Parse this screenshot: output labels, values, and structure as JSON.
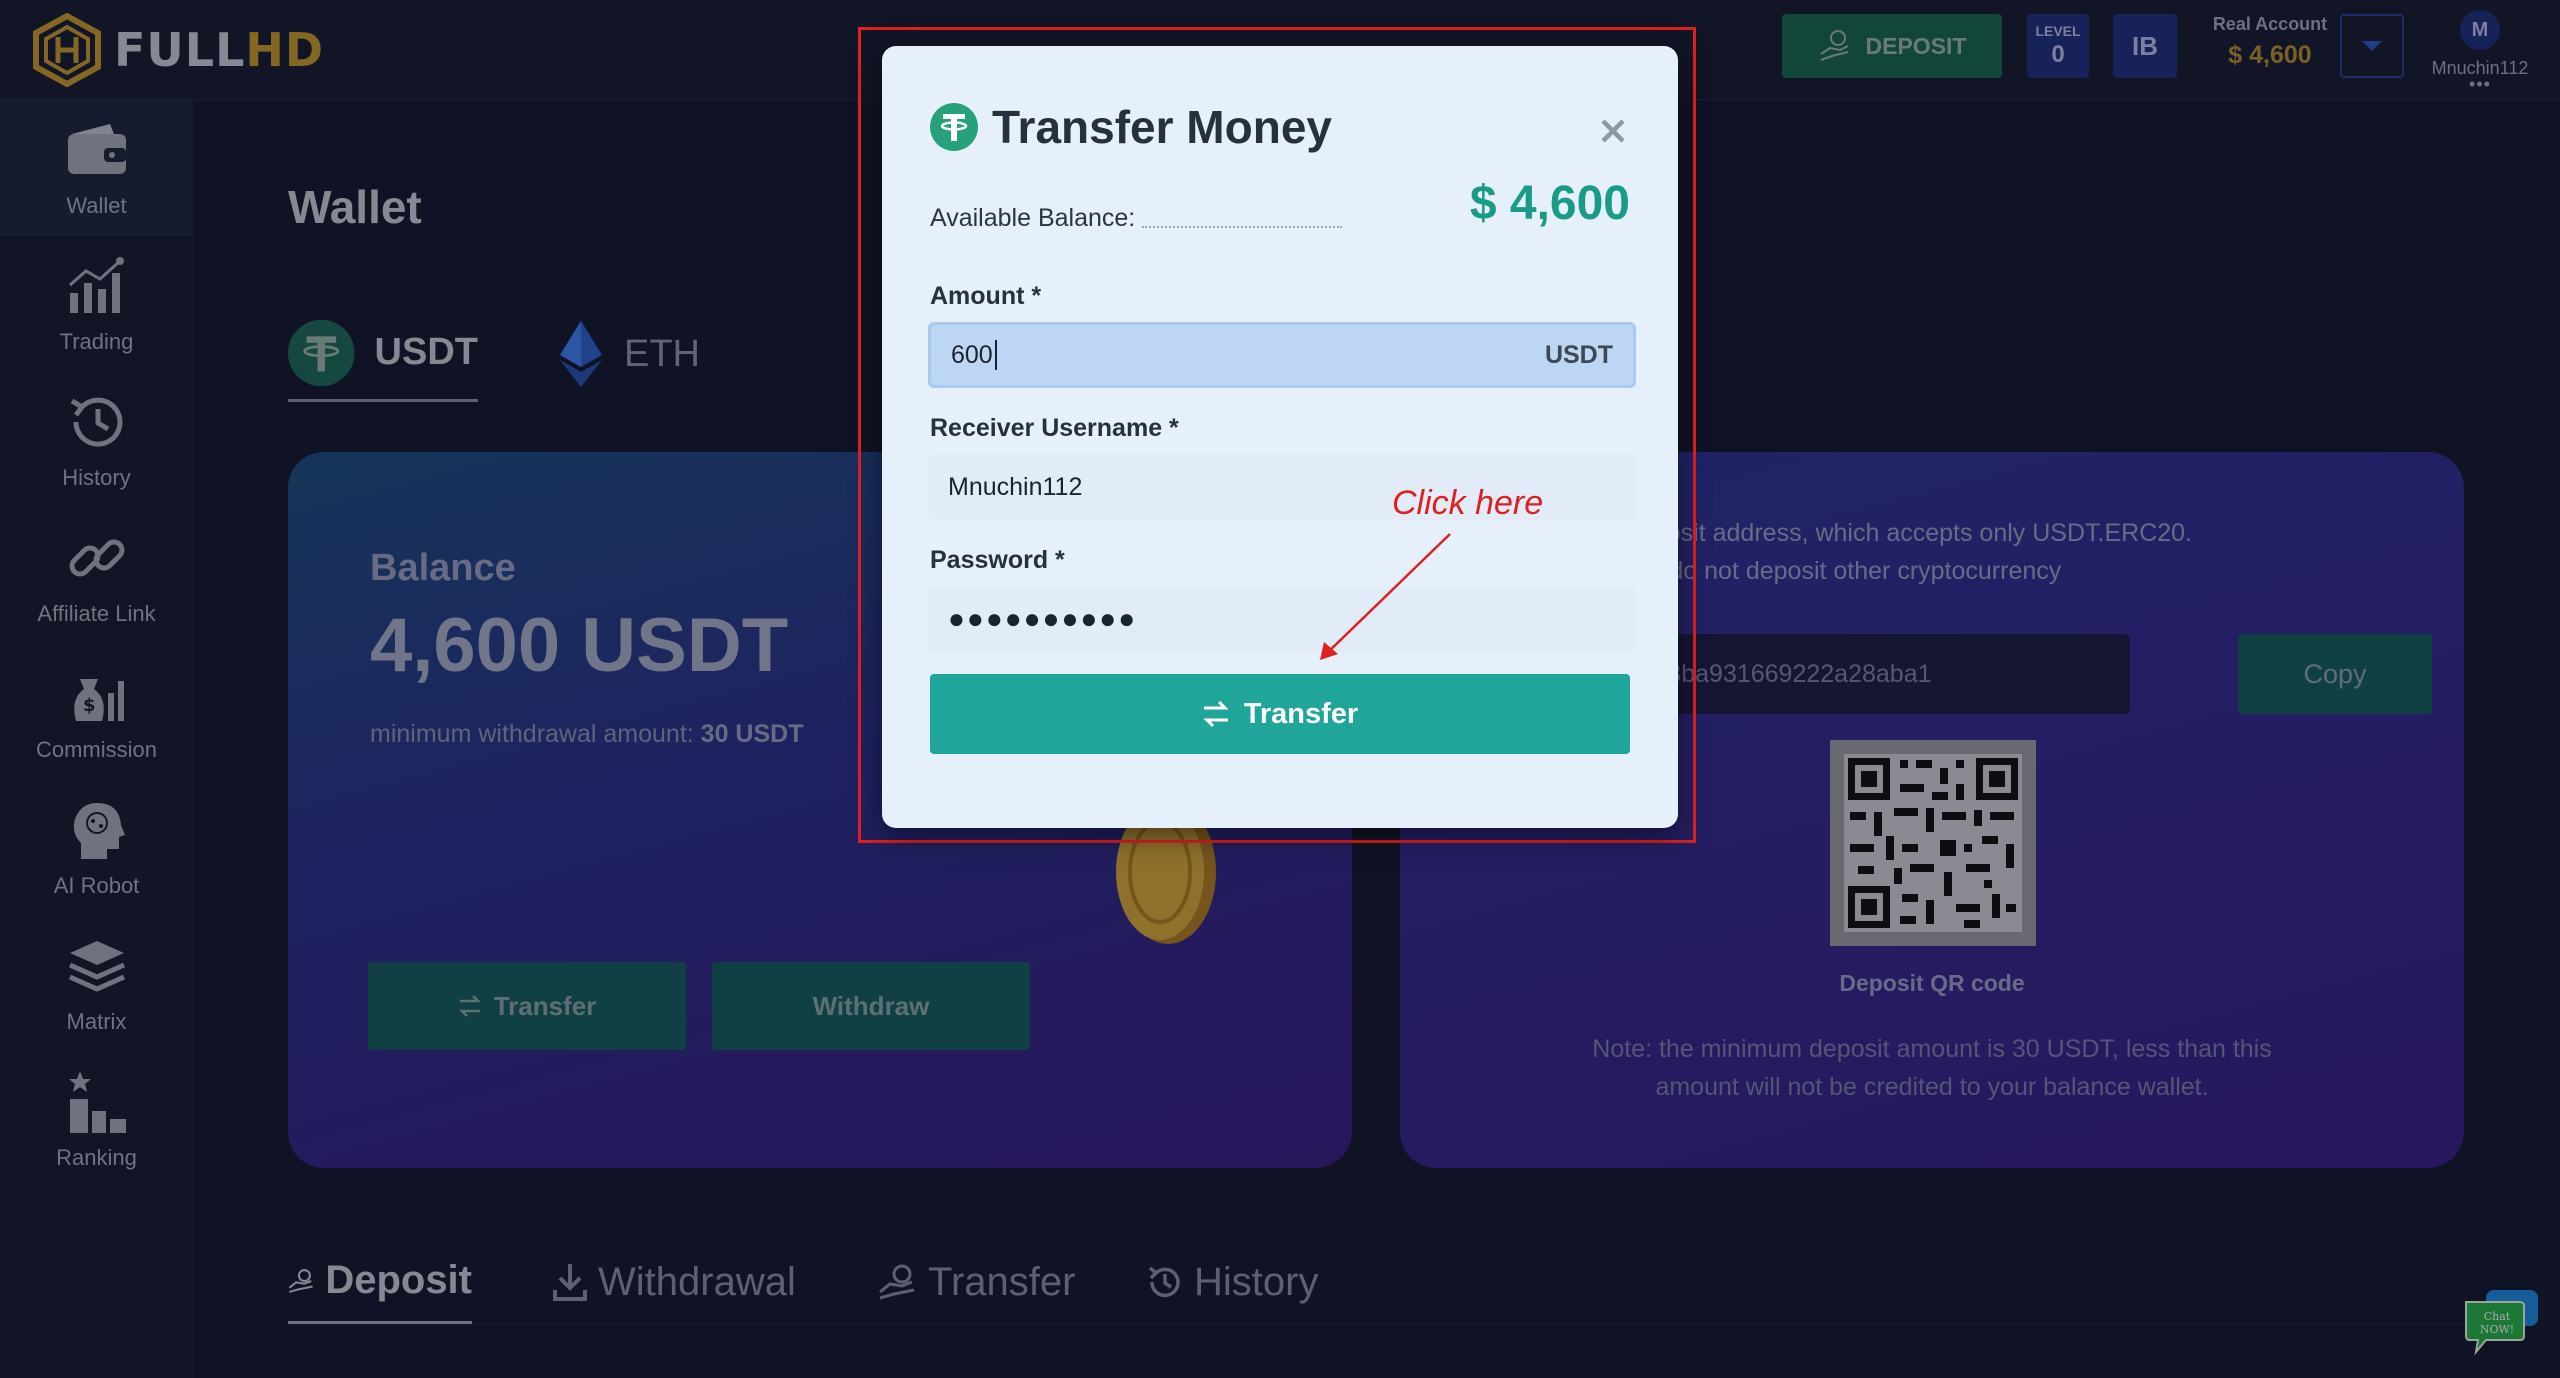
{
  "app": {
    "logo_full": "FULL",
    "logo_hd": "HD"
  },
  "header": {
    "deposit_label": "DEPOSIT",
    "level_label": "LEVEL",
    "level_value": "0",
    "ib_label": "IB",
    "account_type": "Real Account",
    "account_balance": "$ 4,600",
    "avatar_initial": "M",
    "username": "Mnuchin112",
    "more": "•••"
  },
  "sidebar": {
    "items": [
      {
        "label": "Wallet",
        "icon": "wallet-icon"
      },
      {
        "label": "Trading",
        "icon": "trading-chart-icon"
      },
      {
        "label": "History",
        "icon": "history-icon"
      },
      {
        "label": "Affiliate Link",
        "icon": "link-icon"
      },
      {
        "label": "Commission",
        "icon": "money-bag-icon"
      },
      {
        "label": "AI Robot",
        "icon": "brain-head-icon"
      },
      {
        "label": "Matrix",
        "icon": "layers-icon"
      },
      {
        "label": "Ranking",
        "icon": "podium-icon"
      }
    ]
  },
  "main": {
    "title": "Wallet",
    "coin_tabs": [
      {
        "label": "USDT",
        "icon": "tether-icon"
      },
      {
        "label": "ETH",
        "icon": "ethereum-icon"
      }
    ],
    "balance_card": {
      "label": "Balance",
      "value": "4,600 USDT",
      "min_prefix": "minimum withdrawal amount:",
      "min_value": "30 USDT",
      "transfer_label": "Transfer",
      "withdraw_label": "Withdraw"
    },
    "deposit_card": {
      "note_line1": "et's deposit address, which accepts only USDT.ERC20.",
      "note_line2": "Please do not deposit other cryptocurrency",
      "address": "5147a983ba931669222a28aba1",
      "copy_label": "Copy",
      "qr_label": "Deposit QR code",
      "note_bottom": "Note: the minimum deposit amount is 30 USDT, less than this amount will not be credited to your balance wallet."
    },
    "bottom_tabs": [
      {
        "label": "Deposit",
        "icon": "deposit-hand-icon",
        "active": true
      },
      {
        "label": "Withdrawal",
        "icon": "download-icon",
        "active": false
      },
      {
        "label": "Transfer",
        "icon": "transfer-hand-icon",
        "active": false
      },
      {
        "label": "History",
        "icon": "history-icon",
        "active": false
      }
    ],
    "chat_widget": {
      "line1": "Chat",
      "line2": "NOW!"
    }
  },
  "modal": {
    "title": "Transfer Money",
    "available_label": "Available Balance:",
    "available_value": "$ 4,600",
    "amount_label": "Amount *",
    "amount_value": "600",
    "amount_suffix": "USDT",
    "receiver_label": "Receiver Username *",
    "receiver_value": "Mnuchin112",
    "password_label": "Password *",
    "password_mask": "●●●●●●●●●●",
    "submit_label": "Transfer"
  },
  "annotation": {
    "text": "Click here",
    "color": "#e02020"
  },
  "colors": {
    "accent_teal": "#1fa59a",
    "balance_green": "#189c87",
    "gold": "#c79a2c",
    "navy_badge": "#20307e"
  }
}
